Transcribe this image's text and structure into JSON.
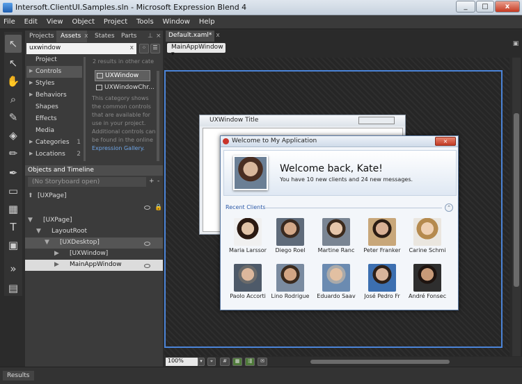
{
  "window": {
    "title": "Intersoft.ClientUI.Samples.sln - Microsoft Expression Blend 4",
    "min": "_",
    "max": "□",
    "close": "x"
  },
  "menu": [
    "File",
    "Edit",
    "View",
    "Object",
    "Project",
    "Tools",
    "Window",
    "Help"
  ],
  "assets_panel": {
    "tabs": [
      "Projects",
      "Assets",
      "States",
      "Parts"
    ],
    "tab_close": "x",
    "search_value": "uxwindow",
    "search_clear": "x",
    "categories": [
      {
        "label": "Project",
        "count": ""
      },
      {
        "label": "Controls",
        "count": ""
      },
      {
        "label": "Styles",
        "count": ""
      },
      {
        "label": "Behaviors",
        "count": ""
      },
      {
        "label": "Shapes",
        "count": ""
      },
      {
        "label": "Effects",
        "count": ""
      },
      {
        "label": "Media",
        "count": ""
      },
      {
        "label": "Categories",
        "count": "1"
      },
      {
        "label": "Locations",
        "count": "2"
      }
    ],
    "results_header": "2 results in other cate",
    "results": [
      "UXWindow",
      "UXWindowChr..."
    ],
    "help_text": "This category shows the common controls that are available for use in your project. Additional controls can be found in the online",
    "help_link": "Expression Gallery.",
    "help_end": ""
  },
  "objects_timeline": {
    "title": "Objects and Timeline",
    "storyboard": "(No Storyboard open)",
    "tree": [
      "[UXPage]",
      "[UXPage]",
      "LayoutRoot",
      "[UXDesktop]",
      "[UXWindow]",
      "MainAppWindow"
    ],
    "plus": "+",
    "minus": "-"
  },
  "document": {
    "tab": "Default.xaml*",
    "tab_close": "x",
    "breadcrumb": "MainAppWindow"
  },
  "design": {
    "uxwindow_title": "UXWindow Title",
    "main_title": "Welcome to My Application",
    "welcome": "Welcome back, Kate!",
    "message": "You have 10 new clients and 24 new messages.",
    "section": "Recent Clients",
    "clients": [
      "Maria Larssor",
      "Diego Roel",
      "Martine Ranc",
      "Peter Franker",
      "Carine Schmi",
      "Paolo Accorti",
      "Lino Rodrigue",
      "Eduardo Saav",
      "José Pedro Fr",
      "André Fonsec"
    ]
  },
  "zoom": "100%",
  "status": {
    "results": "Results"
  },
  "colors": {
    "accent": "#3f7bd4",
    "selected": "#5a5a5a"
  }
}
